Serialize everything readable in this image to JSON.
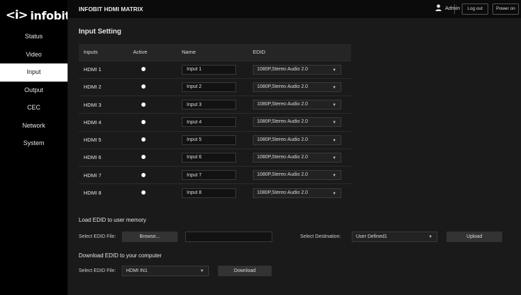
{
  "logo": {
    "mark": "<i>",
    "text": "infobit"
  },
  "sidebar": {
    "items": [
      {
        "label": "Status",
        "active": false
      },
      {
        "label": "Video",
        "active": false
      },
      {
        "label": "Input",
        "active": true
      },
      {
        "label": "Output",
        "active": false
      },
      {
        "label": "CEC",
        "active": false
      },
      {
        "label": "Network",
        "active": false
      },
      {
        "label": "System",
        "active": false
      }
    ]
  },
  "header": {
    "title": "INFOBIT HDMI MATRIX",
    "user": "Admin",
    "logout_label": "Log out",
    "power_label": "Power on"
  },
  "input_setting": {
    "title": "Input Setting",
    "columns": [
      "Inputs",
      "Active",
      "Name",
      "EDID"
    ],
    "rows": [
      {
        "input": "HDMI 1",
        "name": "Input 1",
        "edid": "1080P,Stereo Audio 2.0"
      },
      {
        "input": "HDMI 2",
        "name": "Input 2",
        "edid": "1080P,Stereo Audio 2.0"
      },
      {
        "input": "HDMI 3",
        "name": "Input 3",
        "edid": "1080P,Stereo Audio 2.0"
      },
      {
        "input": "HDMI 4",
        "name": "Input 4",
        "edid": "1080P,Stereo Audio 2.0"
      },
      {
        "input": "HDMI 5",
        "name": "Input 5",
        "edid": "1080P,Stereo Audio 2.0"
      },
      {
        "input": "HDMI 6",
        "name": "Input 6",
        "edid": "1080P,Stereo Audio 2.0"
      },
      {
        "input": "HDMI 7",
        "name": "Input 7",
        "edid": "1080P,Stereo Audio 2.0"
      },
      {
        "input": "HDMI 8",
        "name": "Input 8",
        "edid": "1080P,Stereo Audio 2.0"
      }
    ]
  },
  "load_edid": {
    "title": "Load EDID to user memory",
    "select_file_label": "Select EDID File:",
    "browse_label": "Browse...",
    "file_value": "",
    "destination_label": "Select Destination:",
    "destination_value": "User Defined1",
    "upload_label": "Upload"
  },
  "download_edid": {
    "title": "Download EDID to your computer",
    "select_file_label": "Select EDID File:",
    "file_value": "HDMI IN1",
    "download_label": "Download"
  },
  "colors": {
    "background": "#1a1a1a",
    "sidebar": "#000000",
    "active_nav": "#ffffff",
    "button": "#333333"
  }
}
